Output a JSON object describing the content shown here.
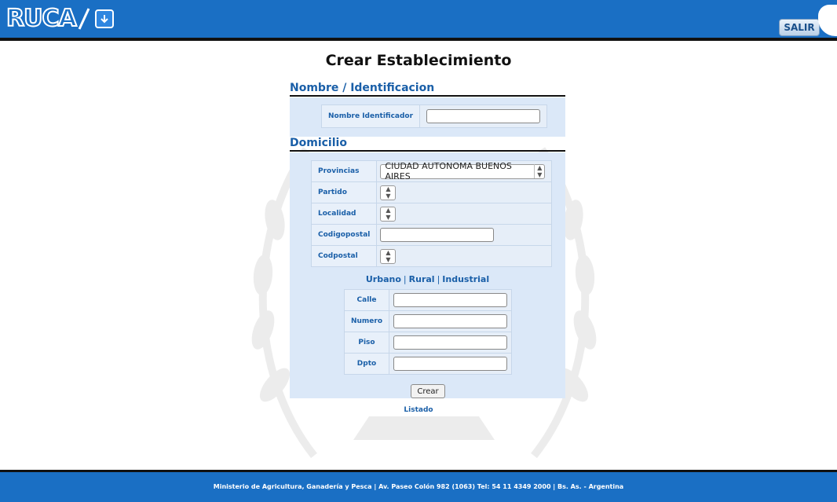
{
  "header": {
    "logo_text": "RUCA",
    "logout_label": "SALIR"
  },
  "page_title": "Crear Establecimiento",
  "section_nombre": {
    "title": "Nombre / Identificacion",
    "field_label": "Nombre Identificador",
    "field_value": ""
  },
  "section_domicilio": {
    "title": "Domicilio",
    "provincias_label": "Provincias",
    "provincias_value": "CIUDAD AUTONOMA BUENOS AIRES",
    "partido_label": "Partido",
    "localidad_label": "Localidad",
    "codigopostal_label": "Codigopostal",
    "codigopostal_value": "",
    "codpostal_label": "Codpostal"
  },
  "type_links": {
    "urbano": "Urbano",
    "rural": "Rural",
    "industrial": "Industrial",
    "separator": "|"
  },
  "address": {
    "calle_label": "Calle",
    "numero_label": "Numero",
    "piso_label": "Piso",
    "dpto_label": "Dpto"
  },
  "actions": {
    "crear_label": "Crear",
    "listado_label": "Listado"
  },
  "footer_text": "Ministerio de Agricultura, Ganadería y Pesca | Av. Paseo Colón 982 (1063) Tel: 54 11 4349 2000 | Bs. As. - Argentina",
  "colors": {
    "primary": "#1a6fc4",
    "link": "#1a5fa8",
    "panel": "#dbe8f8"
  }
}
